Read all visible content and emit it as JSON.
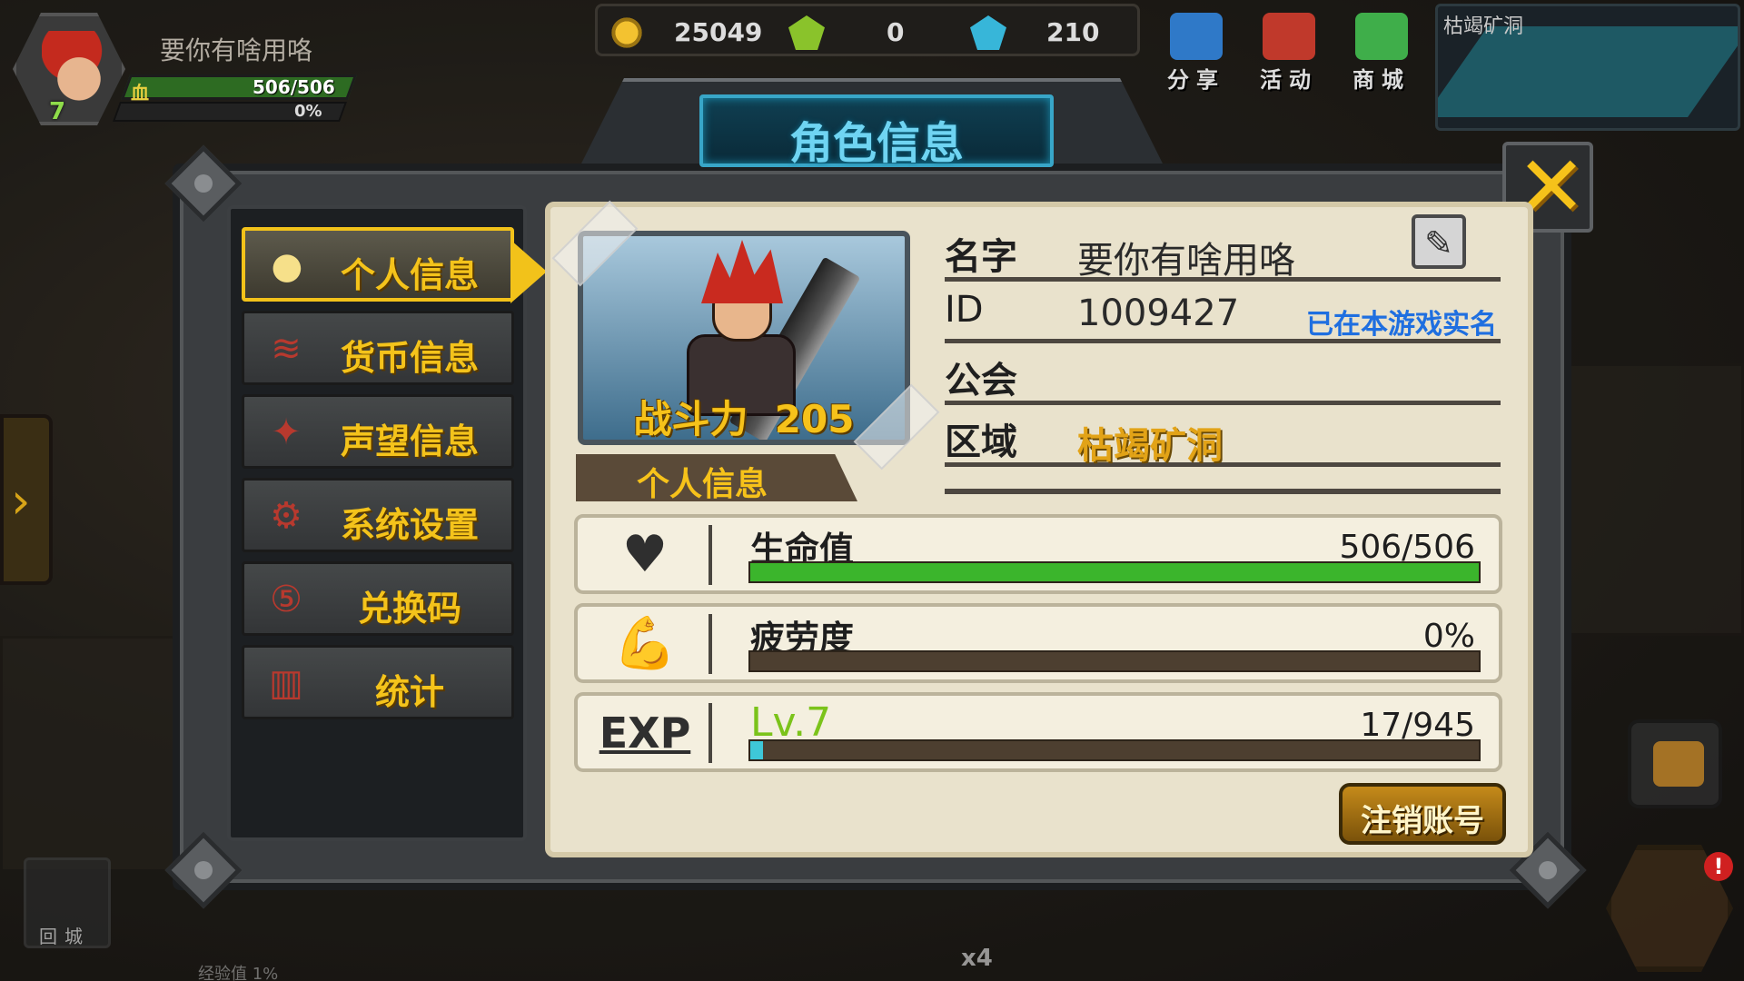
{
  "hud": {
    "player_name": "要你有啥用咯",
    "level": "7",
    "hp_label": "血",
    "hp_text": "506/506",
    "fatigue_text": "0%"
  },
  "currency": {
    "gold": "25049",
    "green_gems": "0",
    "blue_gems": "210"
  },
  "top_buttons": {
    "share": "分享",
    "events": "活动",
    "shop": "商城"
  },
  "minimap": {
    "area_name": "枯竭矿洞"
  },
  "dialog": {
    "title": "角色信息"
  },
  "sidebar": {
    "items": [
      {
        "label": "个人信息",
        "icon": "lightbulb-icon",
        "active": true
      },
      {
        "label": "货币信息",
        "icon": "coins-icon",
        "active": false
      },
      {
        "label": "声望信息",
        "icon": "emblem-icon",
        "active": false
      },
      {
        "label": "系统设置",
        "icon": "gear-icon",
        "active": false
      },
      {
        "label": "兑换码",
        "icon": "code-icon",
        "active": false
      },
      {
        "label": "统计",
        "icon": "stats-icon",
        "active": false
      }
    ]
  },
  "portrait": {
    "power_label": "战斗力",
    "power_value": "205",
    "caption": "个人信息"
  },
  "info": {
    "name_label": "名字",
    "name_value": "要你有啥用咯",
    "id_label": "ID",
    "id_value": "1009427",
    "realname_status": "已在本游戏实名",
    "guild_label": "公会",
    "guild_value": "",
    "region_label": "区域",
    "region_value": "枯竭矿洞"
  },
  "stats": {
    "hp": {
      "label": "生命值",
      "value": "506/506",
      "fill": 1.0,
      "color": "#3bb52c"
    },
    "fatigue": {
      "label": "疲劳度",
      "value": "0%",
      "fill": 0.0,
      "color": "#3bb52c"
    },
    "exp": {
      "icon_text": "EXP",
      "label": "Lv.7",
      "value": "17/945",
      "fill": 0.018,
      "color": "#3ec7d8"
    }
  },
  "buttons": {
    "logout": "注销账号"
  },
  "bottom_hud": {
    "town_label": "回城",
    "exp_hint": "经验值 1%",
    "pet_count": "x4"
  }
}
